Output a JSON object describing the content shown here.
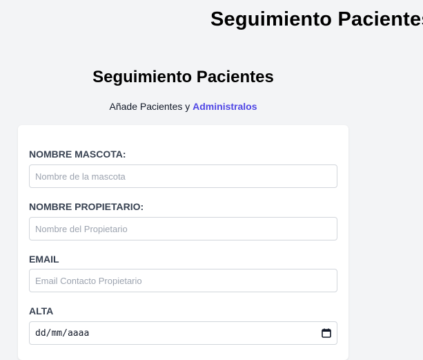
{
  "page": {
    "header_title": "Seguimiento Pacientes"
  },
  "form_section": {
    "title": "Seguimiento Pacientes",
    "subtitle_prefix": "Añade Pacientes y ",
    "subtitle_accent": "Administralos",
    "accent_color": "#4f46e5"
  },
  "form": {
    "fields": [
      {
        "label": "NOMBRE MASCOTA:",
        "placeholder": "Nombre de la mascota",
        "value": ""
      },
      {
        "label": "NOMBRE PROPIETARIO:",
        "placeholder": "Nombre del Propietario",
        "value": ""
      },
      {
        "label": "EMAIL",
        "placeholder": "Email Contacto Propietario",
        "value": ""
      },
      {
        "label": "ALTA",
        "date_placeholder": "dd/mm/aaaa",
        "icon": "calendar-icon"
      }
    ]
  }
}
